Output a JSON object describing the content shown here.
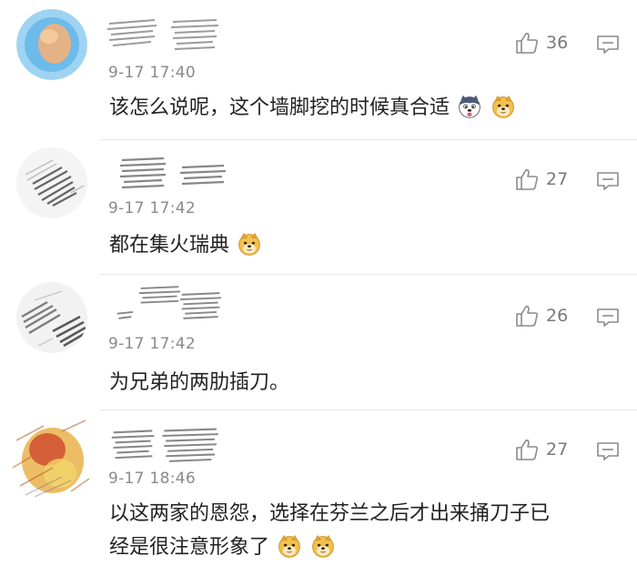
{
  "comments": [
    {
      "time": "9-17 17:40",
      "likes": "36",
      "text": "该怎么说呢，这个墙脚挖的时候真合适",
      "emojis_after": [
        "husky-emoji",
        "doge-emoji"
      ],
      "avatar_color": "#5fb6ea"
    },
    {
      "time": "9-17 17:42",
      "likes": "27",
      "text": "都在集火瑞典",
      "emojis_after": [
        "doge-emoji"
      ],
      "avatar_color": "#9a9a9a"
    },
    {
      "time": "9-17 17:42",
      "likes": "26",
      "text": "为兄弟的两肋插刀。",
      "emojis_after": [],
      "avatar_color": "#8c8c8c"
    },
    {
      "time": "9-17 18:46",
      "likes": "27",
      "text_line1": "以这两家的恩怨，选择在芬兰之后才出来捅刀子已",
      "text_line2": "经是很注意形象了",
      "emojis_after": [
        "doge-emoji",
        "doge-emoji"
      ],
      "avatar_color": "#d9882e"
    }
  ],
  "icons": {
    "like": "thumbs-up-icon",
    "reply": "comment-icon"
  },
  "colors": {
    "time": "#8a8a8a",
    "count": "#7a7a7a",
    "divider": "#e6e6e6"
  }
}
